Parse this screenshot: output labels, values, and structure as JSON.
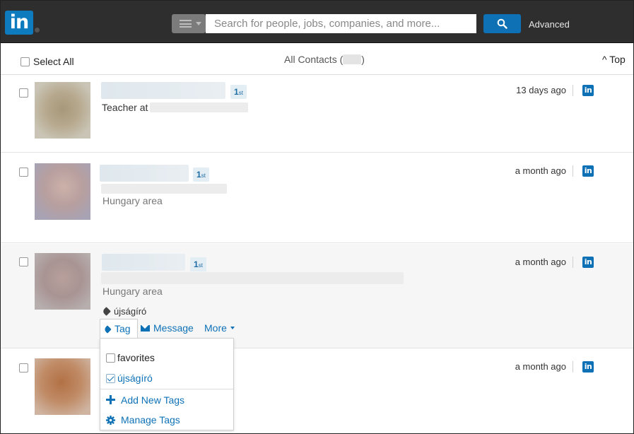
{
  "topbar": {
    "logo_text": "in",
    "search_placeholder": "Search for people, jobs, companies, and more...",
    "advanced_label": "Advanced"
  },
  "header": {
    "select_all_label": "Select All",
    "all_contacts_prefix": "All Contacts (",
    "all_contacts_suffix": ")",
    "top_label": "^ Top"
  },
  "contacts": [
    {
      "degree": "1",
      "degree_suffix": "st",
      "subtitle": "Teacher at",
      "location": "",
      "time": "13 days ago"
    },
    {
      "degree": "1",
      "degree_suffix": "st",
      "subtitle": "",
      "location": "Hungary area",
      "time": "a month ago"
    },
    {
      "degree": "1",
      "degree_suffix": "st",
      "subtitle": "",
      "location": "Hungary area",
      "time": "a month ago",
      "tag": "újságíró"
    },
    {
      "degree": "",
      "degree_suffix": "",
      "subtitle": "",
      "location": "",
      "time": "a month ago"
    }
  ],
  "actions": {
    "tag_label": "Tag",
    "message_label": "Message",
    "more_label": "More"
  },
  "tag_menu": {
    "options": [
      {
        "label": "favorites",
        "checked": false
      },
      {
        "label": "újságíró",
        "checked": true
      }
    ],
    "add_new_label": "Add New Tags",
    "manage_label": "Manage Tags"
  },
  "colors": {
    "linkedin_blue": "#0e71b6",
    "topbar_bg": "#2e2e2e"
  },
  "icons": [
    "linkedin-logo",
    "menu-icon",
    "search-icon",
    "checkbox-icon",
    "tag-icon",
    "envelope-icon",
    "chevron-down-icon",
    "plus-icon",
    "gear-icon",
    "linkedin-icon"
  ]
}
